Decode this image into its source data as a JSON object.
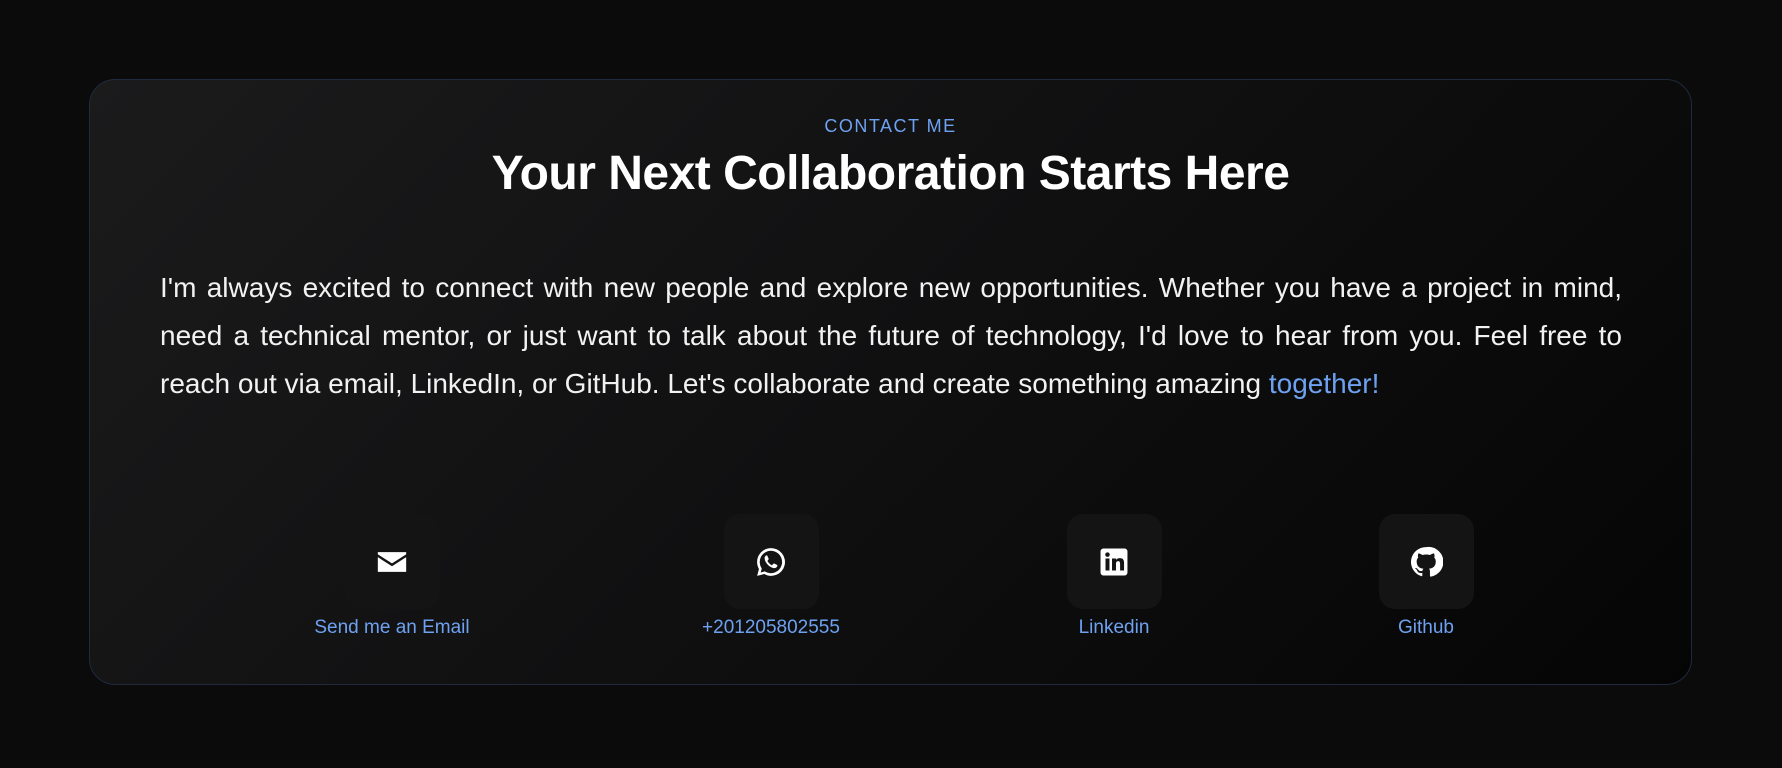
{
  "contact": {
    "eyebrow": "CONTACT ME",
    "title": "Your Next Collaboration Starts Here",
    "intro_text": "I'm always excited to connect with new people and explore new opportunities. Whether you have a project in mind, need a technical mentor, or just want to talk about the future of technology, I'd love to hear from you. Feel free to reach out via email, LinkedIn, or GitHub. Let's collaborate and create something amazing ",
    "intro_highlight": "together!",
    "accent_color": "#6ea1f0",
    "links": [
      {
        "label": "Send me an Email",
        "icon": "envelope-icon"
      },
      {
        "label": "+201205802555",
        "icon": "whatsapp-icon"
      },
      {
        "label": "Linkedin",
        "icon": "linkedin-icon"
      },
      {
        "label": "Github",
        "icon": "github-icon"
      }
    ]
  }
}
